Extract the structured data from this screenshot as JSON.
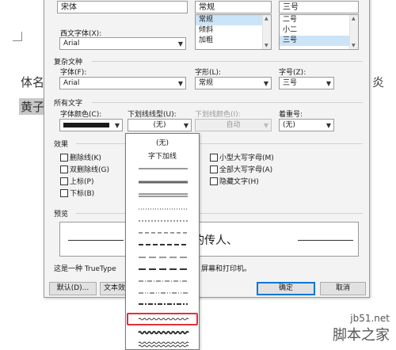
{
  "document": {
    "text_left1": "体名",
    "text_left2": "黄子",
    "text_right1": "炎"
  },
  "font_section": {
    "chinese_font_value": "宋体",
    "style_value": "常规",
    "size_value": "三号",
    "style_list": [
      "常规",
      "倾斜",
      "加粗"
    ],
    "size_list": [
      "二号",
      "小二",
      "三号"
    ],
    "western_font_label": "西文字体(X):",
    "western_font_value": "Arial"
  },
  "complex_section": {
    "title": "复杂文种",
    "font_label": "字体(F):",
    "font_value": "Arial",
    "style_label": "字形(L):",
    "style_value": "常规",
    "size_label": "字号(Z):",
    "size_value": "三号"
  },
  "all_text_section": {
    "title": "所有文字",
    "color_label": "字体颜色(C):",
    "color_value": "#1a1a1a",
    "underline_type_label": "下划线线型(U):",
    "underline_type_value": "(无)",
    "underline_color_label": "下划线颜色(I):",
    "underline_color_value": "自动",
    "emphasis_label": "着重号:",
    "emphasis_value": "(无)"
  },
  "effects_section": {
    "title": "效果",
    "left_checks": [
      "删除线(K)",
      "双删除线(G)",
      "上标(P)",
      "下标(B)"
    ],
    "right_checks": [
      "小型大写字母(M)",
      "全部大写字母(A)",
      "隐藏文字(H)"
    ]
  },
  "preview_section": {
    "title": "预览",
    "sample_text": "的传人、",
    "note_left": "这是一种 TrueType",
    "note_right": "屏幕和打印机。"
  },
  "buttons": {
    "default": "默认(D)...",
    "text_effects": "文本效",
    "ok": "确定",
    "cancel": "取消"
  },
  "underline_dropdown": {
    "none_label": "(无)",
    "words_only_label": "字下加线",
    "line_styles": [
      "single",
      "thick",
      "double",
      "dotted",
      "dashed-fine",
      "dashed",
      "dashed-heavy",
      "long-dash",
      "dash-dot",
      "dash-dot-dot",
      "dash-dot-heavy",
      "wave",
      "wave-heavy",
      "wave-double"
    ],
    "highlighted_style": "wave",
    "highlight_color": "#e0313a"
  },
  "watermark": {
    "line1": "jb51.net",
    "line2": "脚本之家"
  }
}
